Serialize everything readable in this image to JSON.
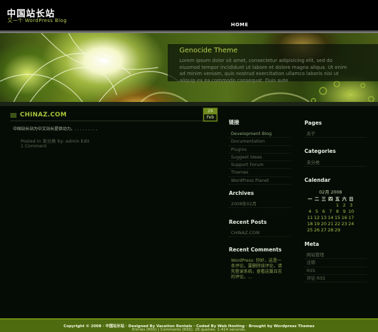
{
  "header": {
    "site_title": "中国站长站",
    "tagline": "又一个 WordPress Blog",
    "nav": [
      {
        "label": "HOME"
      }
    ]
  },
  "banner": {
    "feature_title": "Genocide Theme",
    "feature_text": "Lorem ipsum dolor sit amet, consectetur adipisicing elit, sed do eiusmod tempor incididunt ut labore et dolore magna aliqua. Ut enim ad minim veniam, quis nostrud exercitation ullamco laboris nisi ut aliquip ex ea commodo consequat. Duis aute"
  },
  "post": {
    "title": "CHINAZ.COM",
    "date_day": "29",
    "date_month": "Feb",
    "content": "中国站长站为中文站长提供动力。. . . . . . . . .",
    "meta": "Posted in 未分类  by: admin Edit",
    "comments": "1 Comment"
  },
  "sidebar_left": {
    "links_title": "链接",
    "links": [
      "Development Blog",
      "Documentation",
      "Plugins",
      "Suggest Ideas",
      "Support Forum",
      "Themes",
      "WordPress Planet"
    ],
    "archives_title": "Archives",
    "archives": [
      "2008年02月"
    ],
    "recent_posts_title": "Recent Posts",
    "recent_posts": [
      "CHINAZ.COM"
    ],
    "recent_comments_title": "Recent Comments",
    "recent_comment_text": "WordPress: 你好，这是一条评论。要删除该评论，请先登录系统，查看这篇日志的评论。..."
  },
  "sidebar_right": {
    "pages_title": "Pages",
    "pages": [
      "关于"
    ],
    "categories_title": "Categories",
    "categories": [
      "未分类"
    ],
    "calendar_title": "Calendar",
    "calendar": {
      "caption": "02月 2008",
      "weekdays": [
        "一",
        "二",
        "三",
        "四",
        "五",
        "六",
        "日"
      ],
      "weeks": [
        [
          "",
          "",
          "",
          "",
          "1",
          "2",
          "3"
        ],
        [
          "4",
          "5",
          "6",
          "7",
          "8",
          "9",
          "10"
        ],
        [
          "11",
          "12",
          "13",
          "14",
          "15",
          "16",
          "17"
        ],
        [
          "18",
          "19",
          "20",
          "21",
          "22",
          "23",
          "24"
        ],
        [
          "25",
          "26",
          "27",
          "28",
          "29",
          "",
          ""
        ]
      ]
    },
    "meta_title": "Meta",
    "meta_links": [
      "网站管理",
      "注销",
      "RSS",
      "评论 RSS"
    ]
  },
  "footer": {
    "line1": "Copyright © 2008 · 中国站长站 · Designed By Vacation Rentals · Coded By Web Hosting · Brought by Wordpress Themes",
    "line2": "Entries (RSS) | Comments (RSS). 26 queries. 1.414 seconds."
  },
  "colors": {
    "background": "#050c06",
    "accent": "#a8c53c",
    "footer": "#4f6b10"
  }
}
